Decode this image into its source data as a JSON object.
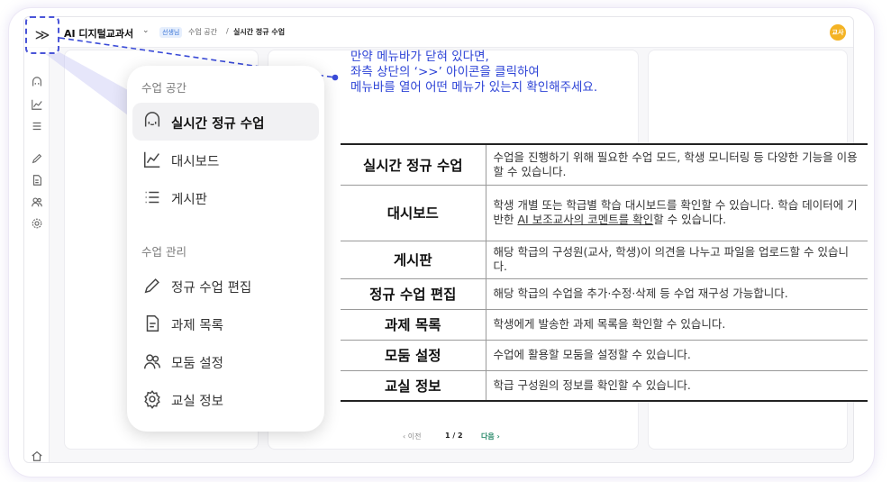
{
  "header": {
    "app_title": "AI 디지털교과서",
    "caret": "⌄",
    "role_badge": "선생님",
    "breadcrumb": [
      "수업 공간",
      "/",
      "실시간 정규 수업"
    ],
    "avatar_label": "교사"
  },
  "expand_button": {
    "label": "≫",
    "icon": "double-chevron-right-icon"
  },
  "rail_icons": [
    "live-class-icon",
    "dashboard-icon",
    "board-icon",
    "edit-icon",
    "assignment-icon",
    "group-icon",
    "settings-icon",
    "home-icon"
  ],
  "menu": {
    "section1": "수업 공간",
    "items1": [
      {
        "label": "실시간 정규 수업",
        "icon": "live-class-icon",
        "active": true
      },
      {
        "label": "대시보드",
        "icon": "dashboard-icon",
        "active": false
      },
      {
        "label": "게시판",
        "icon": "board-icon",
        "active": false
      }
    ],
    "section2": "수업 관리",
    "items2": [
      {
        "label": "정규 수업 편집",
        "icon": "pencil-icon"
      },
      {
        "label": "과제 목록",
        "icon": "document-icon"
      },
      {
        "label": "모둠 설정",
        "icon": "group-icon"
      },
      {
        "label": "교실 정보",
        "icon": "gear-icon"
      }
    ]
  },
  "callout": {
    "line1": "만약 메뉴바가 닫혀 있다면,",
    "line2": "좌측 상단의 ‘>>’ 아이콘을 클릭하여",
    "line3": "메뉴바를 열어 어떤 메뉴가 있는지 확인해주세요.",
    "color": "#2d43d6"
  },
  "table": {
    "rows": [
      {
        "term": "실시간 정규 수업",
        "desc": "수업을 진행하기 위해 필요한 수업 모드, 학생 모니터링 등 다양한 기능을 이용할 수 있습니다."
      },
      {
        "term": "대시보드",
        "desc_a": "학생 개별 또는 학급별 학습 대시보드를 확인할 수 있습니다. 학습 데이터에 기반한 ",
        "desc_u": "AI 보조교사의 코멘트를 확인",
        "desc_b": "할 수 있습니다."
      },
      {
        "term": "게시판",
        "desc": "해당 학급의 구성원(교사, 학생)이 의견을 나누고 파일을 업로드할 수 있습니다."
      },
      {
        "term": "정규 수업 편집",
        "desc": "해당 학급의 수업을 추가·수정·삭제 등 수업 재구성 가능합니다."
      },
      {
        "term": "과제 목록",
        "desc": "학생에게 발송한 과제 목록을 확인할 수 있습니다."
      },
      {
        "term": "모둠 설정",
        "desc": "수업에 활용할 모둠을 설정할 수 있습니다."
      },
      {
        "term": "교실 정보",
        "desc": "학급 구성원의 정보를 확인할 수 있습니다."
      }
    ]
  },
  "pager": {
    "prev": "‹ 이전",
    "page": "1 / 2",
    "next": "다음 ›"
  },
  "colors": {
    "accent": "#2d43d6",
    "avatar": "#f4b324",
    "badge": "#3a74d6"
  }
}
